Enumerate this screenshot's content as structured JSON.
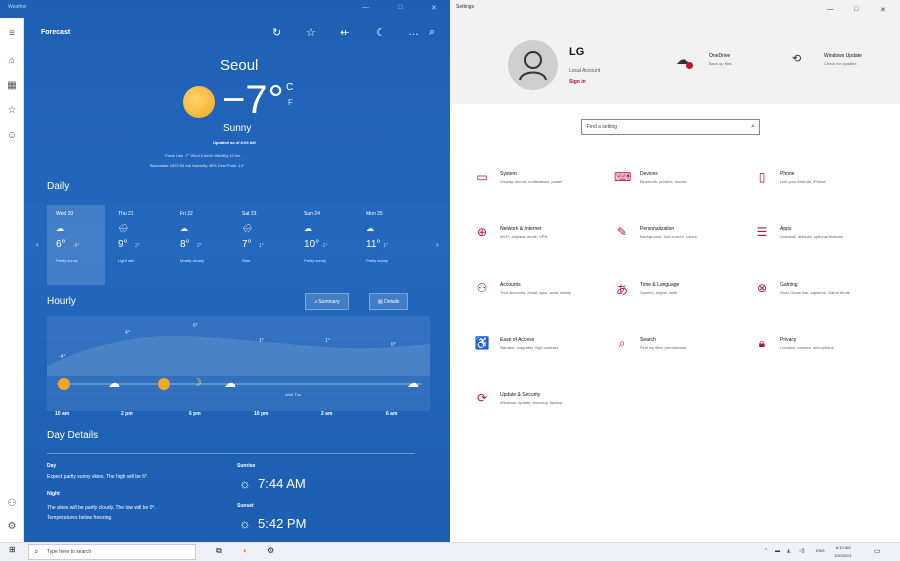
{
  "weather": {
    "window_title": "Weather",
    "header_title": "Forecast",
    "city": "Seoul",
    "temperature": "−7°",
    "unit_c": "C",
    "unit_f": "F",
    "condition": "Sunny",
    "updated": "Updated as of 8:09 AM",
    "details_line1": "Feels Like  -7°    Wind  0 km/h    Visibility  10 km",
    "details_line2": "Barometer  1022.00 mb    Humidity  45%    Dew Point  -14°",
    "daily_label": "Daily",
    "days": [
      {
        "name": "Wed 20",
        "icon": "☁",
        "hi": "6°",
        "lo": "-8°",
        "cond": "Partly sunny"
      },
      {
        "name": "Thu 21",
        "icon": "🌧",
        "hi": "9°",
        "lo": "2°",
        "cond": "Light rain"
      },
      {
        "name": "Fri 22",
        "icon": "☁",
        "hi": "8°",
        "lo": "2°",
        "cond": "Mostly cloudy"
      },
      {
        "name": "Sat 23",
        "icon": "🌧",
        "hi": "7°",
        "lo": "1°",
        "cond": "Rain"
      },
      {
        "name": "Sun 24",
        "icon": "☁",
        "hi": "10°",
        "lo": "-1°",
        "cond": "Partly sunny"
      },
      {
        "name": "Mon 25",
        "icon": "☁",
        "hi": "11°",
        "lo": "1°",
        "cond": "Partly sunny"
      }
    ],
    "hourly_label": "Hourly",
    "summary_label": "Summary",
    "details_label": "Details",
    "hourly_temps": [
      "-4°",
      "4°",
      "6°",
      "1°",
      "1°",
      "0°"
    ],
    "hourly_times": [
      "10 am",
      "2 pm",
      "6 pm",
      "10 pm",
      "2 am",
      "6 am"
    ],
    "chart_marker": "Wed   Thu",
    "day_details_label": "Day Details",
    "day_title": "Day",
    "day_text": "Expect partly sunny skies. The high will be 6°.",
    "night_title": "Night",
    "night_text1": "The skies will be partly cloudy. The low will be 0°.",
    "night_text2": "Temperatures below freezing.",
    "sunrise_label": "Sunrise",
    "sunrise": "7:44 AM",
    "sunset_label": "Sunset",
    "sunset": "5:42 PM"
  },
  "settings": {
    "window_title": "Settings",
    "user_name": "LG",
    "account_type": "Local Account",
    "sign_in": "Sign in",
    "onedrive": "OneDrive",
    "onedrive_sub": "Back up files",
    "update": "Windows Update",
    "update_sub": "Check for updates",
    "search_placeholder": "Find a setting",
    "categories": [
      {
        "name": "System",
        "desc": "Display, sound, notifications, power"
      },
      {
        "name": "Devices",
        "desc": "Bluetooth, printers, mouse"
      },
      {
        "name": "Phone",
        "desc": "Link your Android, iPhone"
      },
      {
        "name": "Network & Internet",
        "desc": "Wi-Fi, airplane mode, VPN"
      },
      {
        "name": "Personalization",
        "desc": "Background, lock screen, colors"
      },
      {
        "name": "Apps",
        "desc": "Uninstall, defaults, optional features"
      },
      {
        "name": "Accounts",
        "desc": "Your accounts, email, sync, work, family"
      },
      {
        "name": "Time & Language",
        "desc": "Speech, region, date"
      },
      {
        "name": "Gaming",
        "desc": "Xbox Game Bar, captures, Game Mode"
      },
      {
        "name": "Ease of Access",
        "desc": "Narrator, magnifier, high contrast"
      },
      {
        "name": "Search",
        "desc": "Find my files, permissions"
      },
      {
        "name": "Privacy",
        "desc": "Location, camera, microphone"
      },
      {
        "name": "Update & Security",
        "desc": "Windows Update, recovery, backup"
      }
    ]
  },
  "taskbar": {
    "search_placeholder": "Type here to search",
    "lang": "ENG",
    "time": "8:10 AM",
    "date": "1/20/2021"
  },
  "colors": {
    "weather_bg": "#1e5fb3",
    "settings_accent": "#b0104a"
  }
}
